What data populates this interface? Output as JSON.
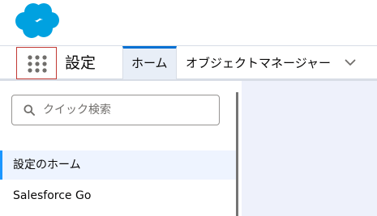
{
  "header": {
    "logo_icon": "salesforce-cloud-logo"
  },
  "nav": {
    "app_launcher_icon": "app-launcher-grid-icon",
    "app_name": "設定",
    "tabs": [
      {
        "label": "ホーム",
        "active": true
      },
      {
        "label": "オブジェクトマネージャー",
        "active": false,
        "has_dropdown": true
      }
    ]
  },
  "sidebar": {
    "search_placeholder": "クイック検索",
    "items": [
      {
        "label": "設定のホーム",
        "active": true
      },
      {
        "label": "Salesforce Go",
        "active": false
      }
    ]
  },
  "colors": {
    "logo_blue": "#00a1e0",
    "active_tab_bg": "#e8eef7",
    "active_tab_border": "#0070d2",
    "launcher_focus_border": "#c23934",
    "sidebar_active_bg": "#eef4ff",
    "sidebar_active_border": "#1b96ff",
    "content_bg": "#eef1fb"
  }
}
